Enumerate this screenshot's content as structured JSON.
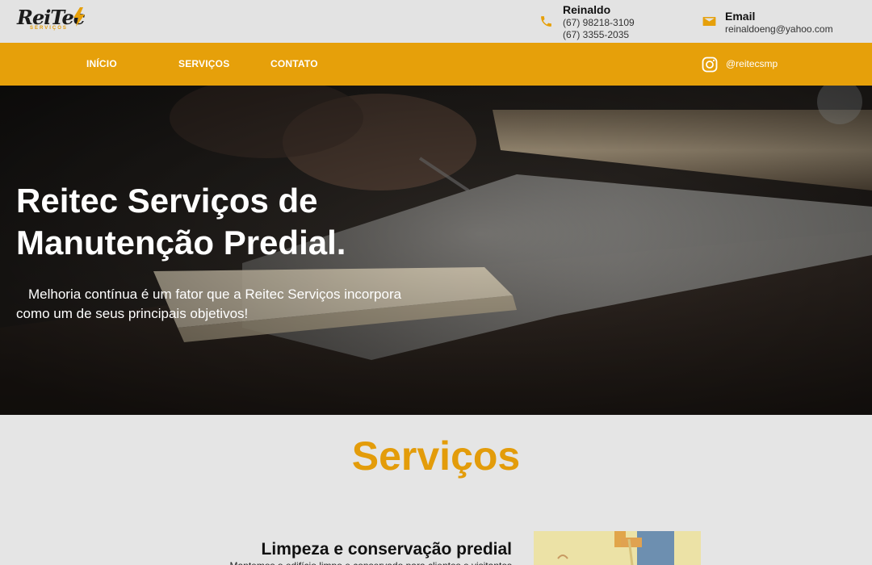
{
  "brand": {
    "logo_text": "ReiTec",
    "logo_sub": "SERVIÇOS",
    "accent_color": "#e6a00a"
  },
  "contacts": [
    {
      "icon": "phone-icon",
      "name": "Reinaldo",
      "lines": [
        "(67) 98218-3109",
        "(67) 3355-2035"
      ]
    },
    {
      "icon": "mail-icon",
      "name": "Email",
      "lines": [
        "reinaldoeng@yahoo.com"
      ]
    }
  ],
  "nav": {
    "items": [
      {
        "label": "INÍCIO"
      },
      {
        "label": "SERVIÇOS"
      },
      {
        "label": "CONTATO"
      }
    ],
    "instagram": {
      "icon": "instagram-icon",
      "handle": "@reitecsmp"
    }
  },
  "hero": {
    "title_lines": [
      "Reitec Serviços de",
      "Manutenção Predial."
    ],
    "subtitle_lines": [
      "Melhoria contínua é um fator que a Reitec Serviços incorpora",
      "como um de seus principais objetivos!"
    ]
  },
  "services": {
    "title": "Serviços",
    "items": [
      {
        "heading": "Limpeza e conservação predial",
        "text": "Mantemos o edifício limpo e conservado para clientes e visitantes"
      }
    ]
  }
}
